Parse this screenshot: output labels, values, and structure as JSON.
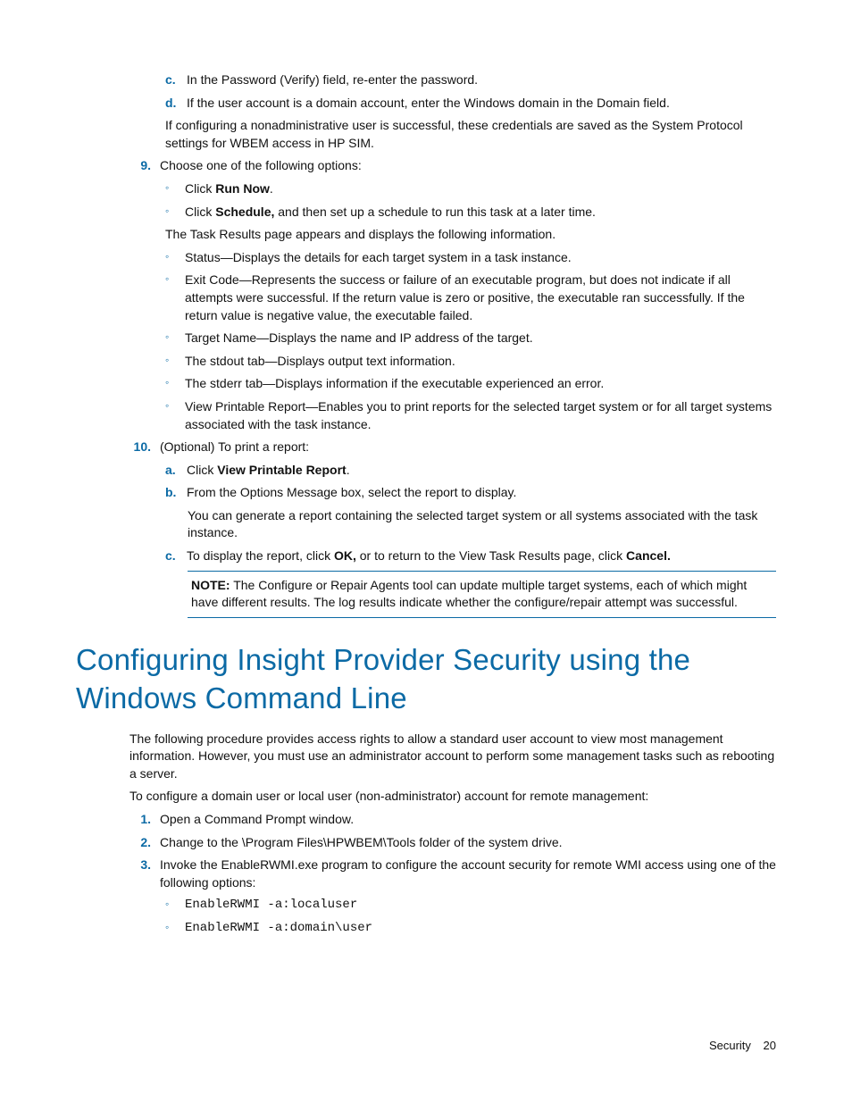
{
  "items": {
    "c_text": "In the Password (Verify) field, re-enter the password.",
    "d_text": "If the user account is a domain account, enter the Windows domain in the Domain field.",
    "d_follow": "If configuring a nonadministrative user is successful, these credentials are saved as the System Protocol settings for WBEM access in HP SIM.",
    "nine_text": "Choose one of the following options:",
    "nine_sub1_pre": "Click ",
    "nine_sub1_bold": "Run Now",
    "nine_sub1_post": ".",
    "nine_sub2_pre": "Click ",
    "nine_sub2_bold": "Schedule,",
    "nine_sub2_post": " and then set up a schedule to run this task at a later time.",
    "nine_follow": "The Task Results page appears and displays the following information.",
    "nine_b1": "Status—Displays the details for each target system in a task instance.",
    "nine_b2": "Exit Code—Represents the success or failure of an executable program, but does not indicate if all attempts were successful. If the return value is zero or positive, the executable ran successfully. If the return value is negative value, the executable failed.",
    "nine_b3": "Target Name—Displays the name and IP address of the target.",
    "nine_b4": "The stdout tab—Displays output text information.",
    "nine_b5": "The stderr tab—Displays information if the executable experienced an error.",
    "nine_b6": "View Printable Report—Enables you to print reports for the selected target system or for all target systems associated with the task instance.",
    "ten_text": "(Optional) To print a report:",
    "ten_a_pre": "Click ",
    "ten_a_bold": "View Printable Report",
    "ten_a_post": ".",
    "ten_b": "From the Options Message box, select the report to display.",
    "ten_b_follow": "You can generate a report containing the selected target system or all systems associated with the task instance.",
    "ten_c_pre": "To display the report, click ",
    "ten_c_bold1": "OK,",
    "ten_c_mid": " or to return to the View Task Results page, click ",
    "ten_c_bold2": "Cancel.",
    "note_label": "NOTE:",
    "note_text": "  The Configure or Repair Agents tool can update multiple target systems, each of which might have different results. The log results indicate whether the configure/repair attempt was successful."
  },
  "heading": "Configuring Insight Provider Security using the Windows Command Line",
  "body2": {
    "p1": "The following procedure provides access rights to allow a standard user account to view most management information. However, you must use an administrator account to perform some management tasks such as rebooting a server.",
    "p2": "To configure a domain user or local user (non-administrator) account for remote management:",
    "s1": "Open a Command Prompt window.",
    "s2": "Change to the \\Program Files\\HPWBEM\\Tools folder of the system drive.",
    "s3": "Invoke the EnableRWMI.exe program to configure the account security for remote WMI access using one of the following options:",
    "o1": "EnableRWMI -a:localuser",
    "o2": "EnableRWMI -a:domain\\user"
  },
  "markers": {
    "c": "c.",
    "d": "d.",
    "nine": "9.",
    "ten": "10.",
    "a": "a.",
    "b": "b.",
    "c2": "c.",
    "one": "1.",
    "two": "2.",
    "three": "3.",
    "circ": "◦"
  },
  "footer": {
    "section": "Security",
    "page": "20"
  }
}
